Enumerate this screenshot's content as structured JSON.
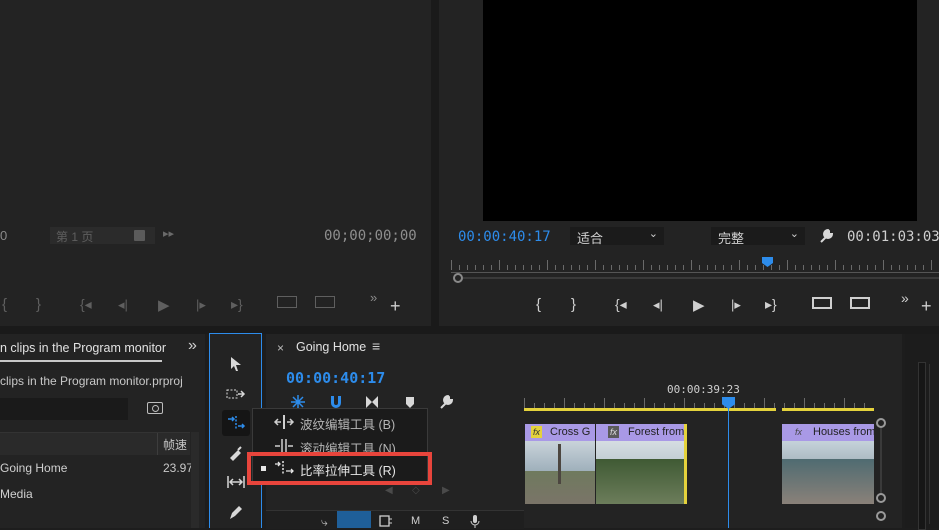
{
  "source_monitor": {
    "page_field": "第 1 页",
    "timecode": "00;00;00;00",
    "left_value": "0"
  },
  "program_monitor": {
    "timecode": "00:00:40:17",
    "fit_select": "适合",
    "quality_select": "完整",
    "duration": "00:01:03:03"
  },
  "project_panel": {
    "tab_title": "n clips in the Program monitor",
    "file_name": "clips in the Program monitor.prproj",
    "col_frame_rate": "帧速",
    "rows": [
      {
        "name": "Going Home",
        "rate": "23.97"
      },
      {
        "name": "Media",
        "rate": ""
      }
    ]
  },
  "timeline": {
    "tab_title": "Going Home",
    "timecode": "00:00:40:17",
    "ruler_time": "00:00:39:23",
    "clips": {
      "cross": "Cross G",
      "forest": "Forest from",
      "houses": "Houses from"
    },
    "track_labels": {
      "m": "M",
      "s": "S"
    }
  },
  "flyout_menu": {
    "items": [
      {
        "label": "波纹编辑工具 (B)",
        "selected": false
      },
      {
        "label": "滚动编辑工具 (N)",
        "selected": false
      },
      {
        "label": "比率拉伸工具 (R)",
        "selected": true
      }
    ]
  },
  "colors": {
    "accent_blue": "#2d8ceb",
    "highlight_red": "#e8453c",
    "clip_label_purple": "#a999e6",
    "clip_yellow": "#e4d23c"
  }
}
